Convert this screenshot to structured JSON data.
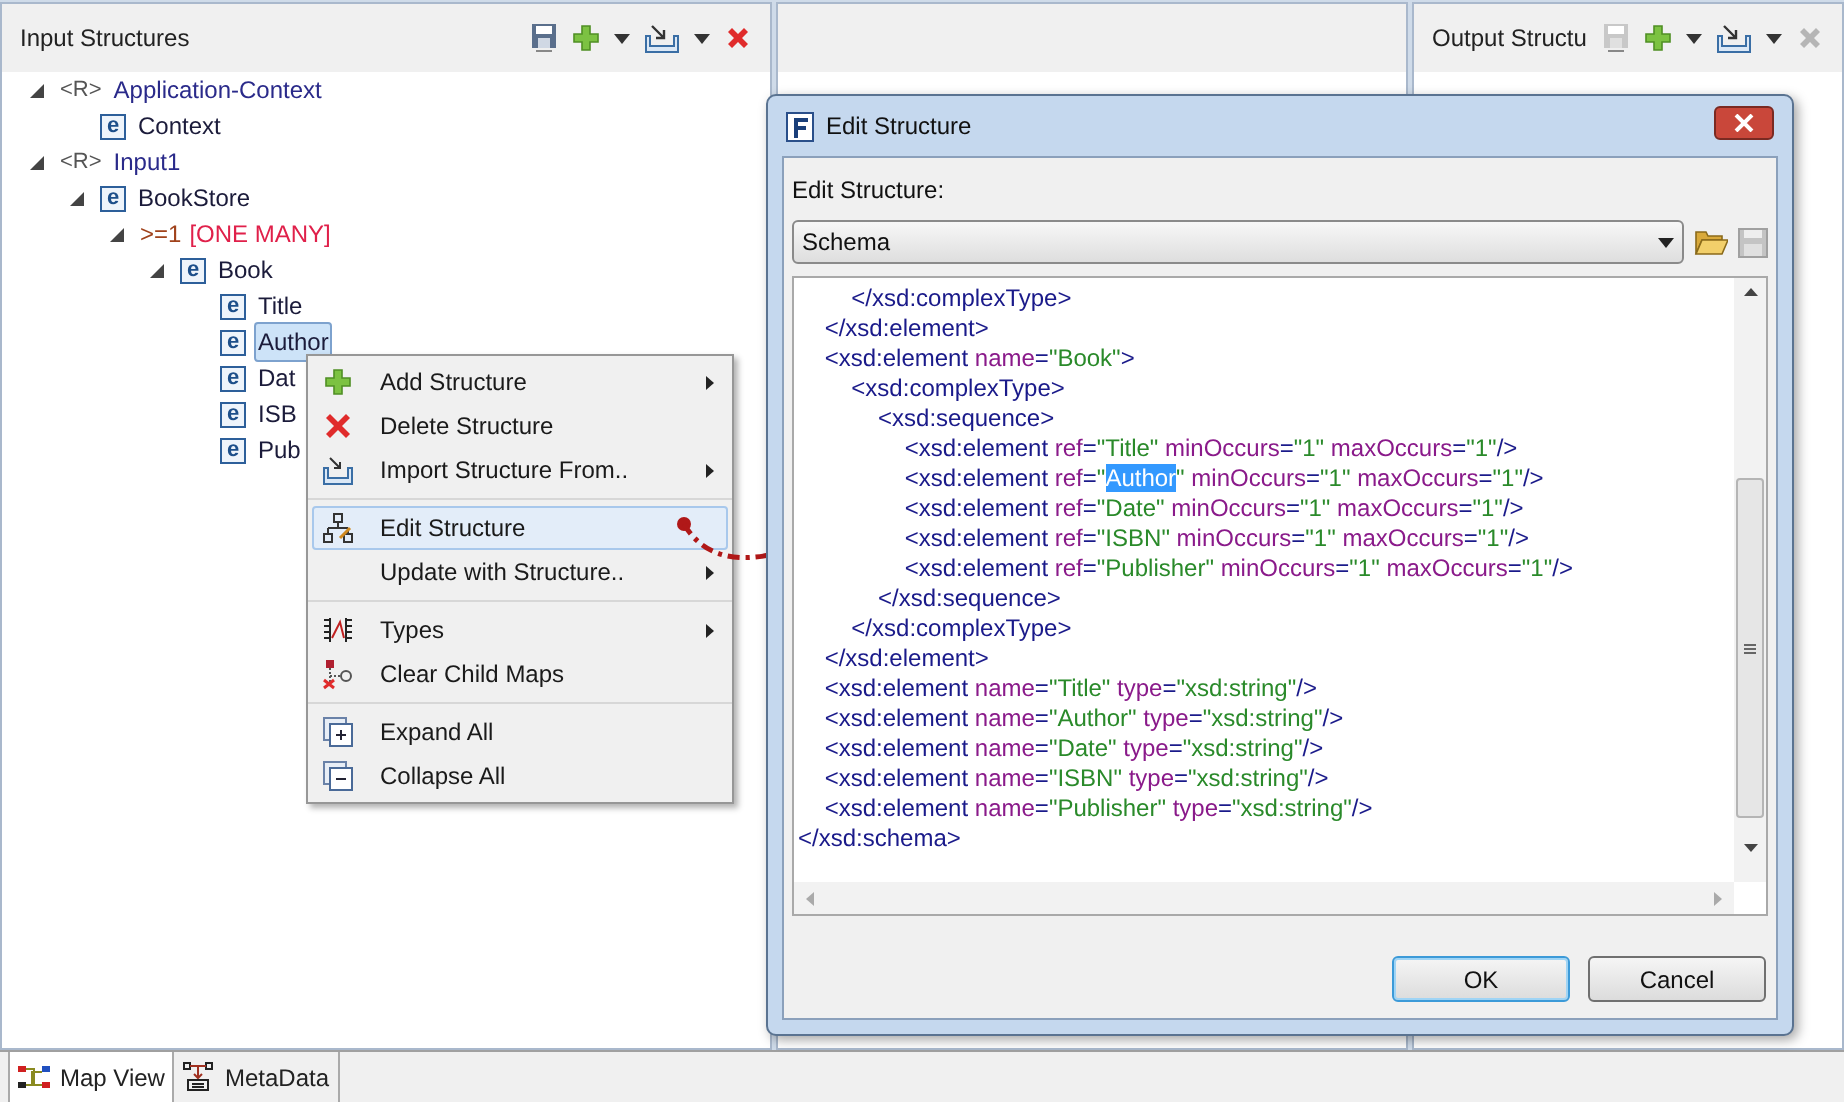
{
  "panes": [
    {
      "title": "Input Structures",
      "tools": [
        {
          "kind": "save",
          "disabled": false
        },
        {
          "kind": "add",
          "disabled": false
        },
        {
          "kind": "dropdown",
          "disabled": false
        },
        {
          "kind": "import",
          "disabled": false
        },
        {
          "kind": "dropdown",
          "disabled": false
        },
        {
          "kind": "delete",
          "disabled": false
        }
      ],
      "tree": [
        {
          "kind": "root",
          "icon": "<R>",
          "label": "Application-Context",
          "expanded": true,
          "selected": false,
          "children": [
            {
              "kind": "element",
              "icon": "e",
              "label": "Context",
              "selected": false
            }
          ]
        },
        {
          "kind": "root",
          "icon": "<R>",
          "label": "Input1",
          "expanded": true,
          "selected": false,
          "children": [
            {
              "kind": "element",
              "icon": "e",
              "label": "BookStore",
              "expanded": true,
              "selected": false,
              "children": [
                {
                  "kind": "multiplicity",
                  "label": ">=1",
                  "note": "[ONE MANY]",
                  "expanded": true,
                  "selected": false,
                  "children": [
                    {
                      "kind": "element",
                      "icon": "e",
                      "label": "Book",
                      "expanded": true,
                      "selected": false,
                      "children": [
                        {
                          "kind": "element",
                          "icon": "e",
                          "label": "Title",
                          "selected": false
                        },
                        {
                          "kind": "element",
                          "icon": "e",
                          "label": "Author",
                          "selected": true
                        },
                        {
                          "kind": "element",
                          "icon": "e",
                          "label": "Dat",
                          "selected": false
                        },
                        {
                          "kind": "element",
                          "icon": "e",
                          "label": "ISB",
                          "selected": false
                        },
                        {
                          "kind": "element",
                          "icon": "e",
                          "label": "Pub",
                          "selected": false
                        }
                      ]
                    }
                  ]
                }
              ]
            }
          ]
        }
      ]
    },
    {
      "title": "Output Structu",
      "tools": [
        {
          "kind": "save",
          "disabled": true
        },
        {
          "kind": "add",
          "disabled": false
        },
        {
          "kind": "dropdown",
          "disabled": false
        },
        {
          "kind": "import",
          "disabled": false
        },
        {
          "kind": "dropdown",
          "disabled": false
        },
        {
          "kind": "delete",
          "disabled": true
        }
      ]
    }
  ],
  "context_menu": {
    "groups": [
      [
        {
          "kind": "add",
          "label": "Add Structure",
          "submenu": true,
          "selected": false
        },
        {
          "kind": "delete",
          "label": "Delete Structure",
          "submenu": false,
          "selected": false
        },
        {
          "kind": "import",
          "label": "Import Structure From..",
          "submenu": true,
          "selected": false
        }
      ],
      [
        {
          "kind": "edit",
          "label": "Edit Structure",
          "submenu": false,
          "selected": true
        },
        {
          "kind": "plain",
          "label": "Update with Structure..",
          "submenu": true,
          "selected": false
        }
      ],
      [
        {
          "kind": "types",
          "label": "Types",
          "submenu": true,
          "selected": false
        },
        {
          "kind": "clear",
          "label": "Clear Child Maps",
          "submenu": false,
          "selected": false
        }
      ],
      [
        {
          "kind": "expand",
          "label": "Expand All",
          "submenu": false,
          "selected": false
        },
        {
          "kind": "collapse",
          "label": "Collapse All",
          "submenu": false,
          "selected": false
        }
      ]
    ]
  },
  "dialog": {
    "title": "Edit Structure",
    "field_label": "Edit Structure:",
    "select": {
      "value": "Schema"
    },
    "code_lines": [
      [
        {
          "text": "        </xsd:complexType>"
        }
      ],
      [
        {
          "text": "    </xsd:element>"
        }
      ],
      [
        {
          "text": "    <xsd:element name=\"Book\">"
        }
      ],
      [
        {
          "text": "        <xsd:complexType>"
        }
      ],
      [
        {
          "text": "            <xsd:sequence>"
        }
      ],
      [
        {
          "text": "                <xsd:element ref=\"Title\" minOccurs=\"1\" maxOccurs=\"1\"/>"
        }
      ],
      [
        {
          "text": "                <xsd:element ref=\""
        },
        {
          "text": "Author",
          "selected": true
        },
        {
          "text": "\" minOccurs=\"1\" maxOccurs=\"1\"/>"
        }
      ],
      [
        {
          "text": "                <xsd:element ref=\"Date\" minOccurs=\"1\" maxOccurs=\"1\"/>"
        }
      ],
      [
        {
          "text": "                <xsd:element ref=\"ISBN\" minOccurs=\"1\" maxOccurs=\"1\"/>"
        }
      ],
      [
        {
          "text": "                <xsd:element ref=\"Publisher\" minOccurs=\"1\" maxOccurs=\"1\"/>"
        }
      ],
      [
        {
          "text": "            </xsd:sequence>"
        }
      ],
      [
        {
          "text": "        </xsd:complexType>"
        }
      ],
      [
        {
          "text": "    </xsd:element>"
        }
      ],
      [
        {
          "text": "    <xsd:element name=\"Title\" type=\"xsd:string\"/>"
        }
      ],
      [
        {
          "text": "    <xsd:element name=\"Author\" type=\"xsd:string\"/>"
        }
      ],
      [
        {
          "text": "    <xsd:element name=\"Date\" type=\"xsd:string\"/>"
        }
      ],
      [
        {
          "text": "    <xsd:element name=\"ISBN\" type=\"xsd:string\"/>"
        }
      ],
      [
        {
          "text": "    <xsd:element name=\"Publisher\" type=\"xsd:string\"/>"
        }
      ],
      [
        {
          "text": "</xsd:schema>"
        }
      ]
    ],
    "buttons": [
      {
        "label": "OK",
        "default": true
      },
      {
        "label": "Cancel",
        "default": false
      }
    ]
  },
  "bottom_tabs": [
    {
      "label": "Map View",
      "kind": "map",
      "selected": true
    },
    {
      "label": "MetaData",
      "kind": "meta",
      "selected": false
    }
  ]
}
